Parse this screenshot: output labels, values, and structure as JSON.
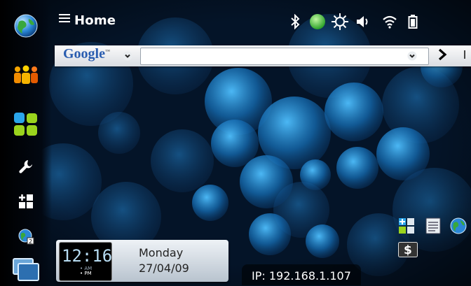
{
  "header": {
    "title": "Home",
    "menu_icon": "menu-icon"
  },
  "status_icons": [
    "bluetooth-icon",
    "presence-online-icon",
    "brightness-icon",
    "volume-icon",
    "wifi-icon",
    "battery-icon"
  ],
  "search": {
    "engine": "Google",
    "engine_mark": "™",
    "url_value": ""
  },
  "sidebar": {
    "items": [
      {
        "icon": "browser-globe-icon"
      },
      {
        "icon": "contacts-icon"
      },
      {
        "icon": "applications-icon"
      },
      {
        "icon": "settings-wrench-icon"
      },
      {
        "icon": "add-widget-icon"
      },
      {
        "icon": "globe-bookmark-icon"
      },
      {
        "icon": "task-switcher-icon"
      }
    ]
  },
  "clock_widget": {
    "time": "12:16",
    "am": "• AM",
    "pm": "• PM",
    "day": "Monday",
    "date": "27/04/09"
  },
  "ip_widget": {
    "text": "IP: 192.168.1.107"
  },
  "desktop_icons": [
    "app-grid-icon",
    "document-icon",
    "globe-icon",
    "currency-converter-icon"
  ],
  "colors": {
    "accent": "#1a8fd9",
    "background": "#03101f",
    "presence": "#2fb52f"
  }
}
